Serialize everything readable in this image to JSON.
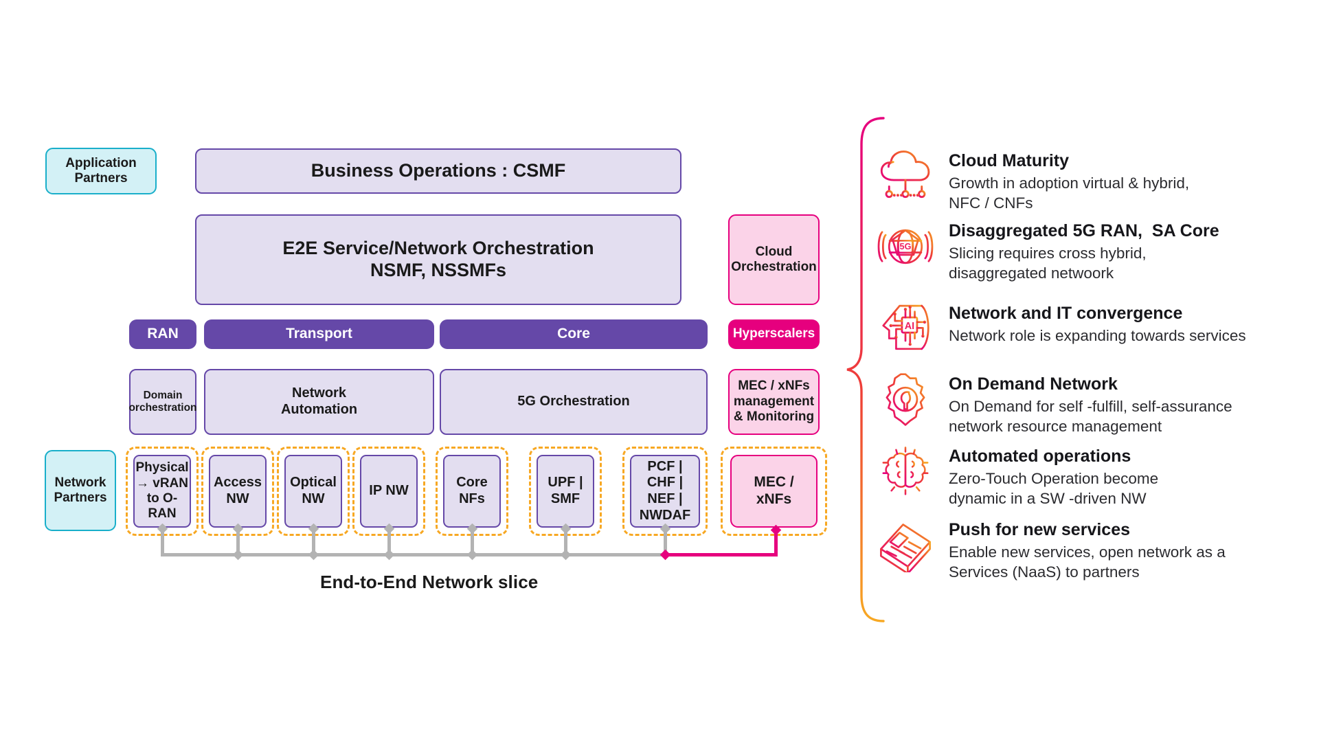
{
  "diagram": {
    "caption": "End-to-End Network slice",
    "colors": {
      "purple": "#6548a8",
      "lilac_fill": "#e3def0",
      "cyan": "#19afca",
      "cyan_fill": "#d3f1f6",
      "pink": "#e6007e",
      "pink_fill": "#fbd3e8",
      "amber_dashed": "#f7a823",
      "connector_gray": "#b3b3b3"
    },
    "left_labels": [
      {
        "id": "application-partners",
        "label": "Application\nPartners"
      },
      {
        "id": "network-partners",
        "label": "Network\nPartners"
      }
    ],
    "top_boxes": [
      {
        "id": "business-operations",
        "label": "Business Operations : CSMF"
      },
      {
        "id": "e2e-orchestration",
        "label": "E2E Service/Network Orchestration\nNSMF, NSSMFs"
      }
    ],
    "domain_bands": [
      {
        "id": "ran",
        "label": "RAN"
      },
      {
        "id": "transport",
        "label": "Transport"
      },
      {
        "id": "core",
        "label": "Core"
      }
    ],
    "orchestration_boxes": [
      {
        "id": "domain-orchestration",
        "label": "Domain\norchestration"
      },
      {
        "id": "network-automation",
        "label": "Network\nAutomation"
      },
      {
        "id": "5g-orchestration",
        "label": "5G Orchestration"
      }
    ],
    "slice_functions": [
      {
        "id": "physical-vran-oran",
        "label": "Physical\n→ vRAN\nto O-RAN"
      },
      {
        "id": "access-nw",
        "label": "Access\nNW"
      },
      {
        "id": "optical-nw",
        "label": "Optical\nNW"
      },
      {
        "id": "ip-nw",
        "label": "IP NW"
      },
      {
        "id": "core-nfs",
        "label": "Core NFs"
      },
      {
        "id": "upf-smf",
        "label": "UPF |\nSMF"
      },
      {
        "id": "pcf-chf-nef-nwdaf",
        "label": "PCF |\nCHF |\nNEF |\nNWDAF"
      }
    ],
    "cloud_column": [
      {
        "id": "cloud-orchestration",
        "label": "Cloud\nOrchestration",
        "style": "pink-light"
      },
      {
        "id": "hyperscalers",
        "label": "Hyperscalers",
        "style": "pink-solid"
      },
      {
        "id": "mec-xnfs-management",
        "label": "MEC / xNFs\nmanagement\n& Monitoring",
        "style": "pink-light"
      },
      {
        "id": "mec-xnfs",
        "label": "MEC /\nxNFs",
        "style": "pink-light"
      }
    ]
  },
  "features": [
    {
      "icon": "cloud-network-icon",
      "title": "Cloud Maturity",
      "desc": "Growth in adoption virtual & hybrid,\nNFC / CNFs"
    },
    {
      "icon": "5g-globe-icon",
      "title": "Disaggregated 5G RAN,  SA Core",
      "desc": "Slicing requires cross  hybrid,\ndisaggregated   netwoork"
    },
    {
      "icon": "ai-head-icon",
      "title": "Network and IT convergence",
      "desc": "Network role is expanding towards services"
    },
    {
      "icon": "gear-wrench-icon",
      "title": "On Demand Network",
      "desc": "On Demand for self -fulfill, self-assurance\nnetwork resource management"
    },
    {
      "icon": "brain-icon",
      "title": "Automated operations",
      "desc": "Zero-Touch Operation become\ndynamic in a SW -driven NW"
    },
    {
      "icon": "newspaper-icon",
      "title": "Push for new services",
      "desc": "Enable new services, open network as a\nServices (NaaS) to partners"
    }
  ]
}
